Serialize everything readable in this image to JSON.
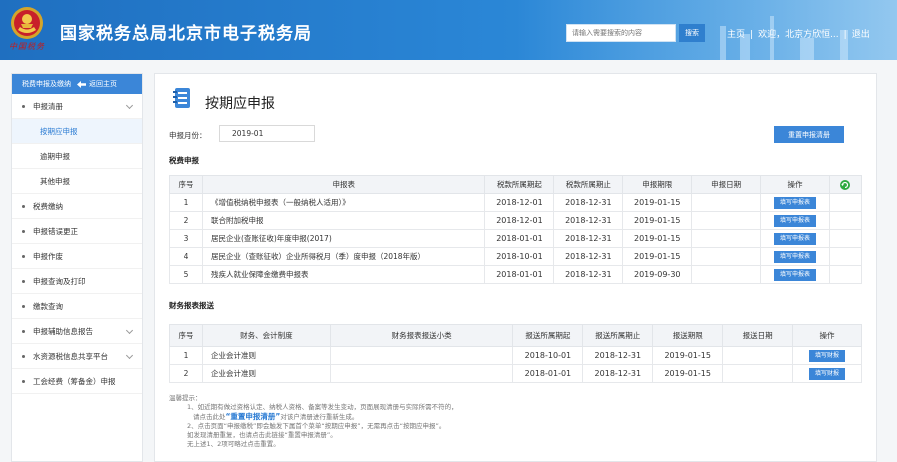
{
  "header": {
    "title": "国家税务总局北京市电子税务局",
    "emblem_text": "中国税务",
    "search_placeholder": "请输入需要搜索的内容",
    "search_button": "搜索",
    "links": [
      "主页",
      "欢迎，北京方欣恒...",
      "退出"
    ],
    "link_separator": "|"
  },
  "sidebar": {
    "head_label": "税费申报及缴纳",
    "back_label": "返回主页",
    "items": [
      {
        "label": "申报清册",
        "expandable": true
      },
      {
        "label": "按期应申报",
        "sub": true,
        "active": true
      },
      {
        "label": "逾期申报",
        "sub": true
      },
      {
        "label": "其他申报",
        "sub": true
      },
      {
        "label": "税费缴纳"
      },
      {
        "label": "申报错误更正"
      },
      {
        "label": "申报作废"
      },
      {
        "label": "申报查询及打印"
      },
      {
        "label": "缴款查询"
      },
      {
        "label": "申报辅助信息报告",
        "expandable": true
      },
      {
        "label": "水资源税信息共享平台",
        "expandable": true
      },
      {
        "label": "工会经费（筹备金）申报"
      }
    ]
  },
  "main": {
    "title": "按期应申报",
    "period_label": "申报月份：",
    "period_value": "2019-01",
    "reset_button": "重置申报清册",
    "tax_section_title": "税费申报",
    "tax_table": {
      "headers": [
        "序号",
        "申报表",
        "税款所属期起",
        "税款所属期止",
        "申报期限",
        "申报日期",
        "操作"
      ],
      "rows": [
        [
          "1",
          "《增值税纳税申报表（一般纳税人适用）》",
          "2018-12-01",
          "2018-12-31",
          "2019-01-15",
          "",
          "填写申报表"
        ],
        [
          "2",
          "联合附加税申报",
          "2018-12-01",
          "2018-12-31",
          "2019-01-15",
          "",
          "填写申报表"
        ],
        [
          "3",
          "居民企业(查账征收)年度申报(2017)",
          "2018-01-01",
          "2018-12-31",
          "2019-01-15",
          "",
          "填写申报表"
        ],
        [
          "4",
          "居民企业（查账征收）企业所得税月（季）度申报（2018年版）",
          "2018-10-01",
          "2018-12-31",
          "2019-01-15",
          "",
          "填写申报表"
        ],
        [
          "5",
          "残疾人就业保障金缴费申报表",
          "2018-01-01",
          "2018-12-31",
          "2019-09-30",
          "",
          "填写申报表"
        ]
      ]
    },
    "finance_section_title": "财务报表报送",
    "finance_table": {
      "headers": [
        "序号",
        "财务、会计制度",
        "财务报表报送小类",
        "报送所属期起",
        "报送所属期止",
        "报送期限",
        "报送日期",
        "操作"
      ],
      "rows": [
        [
          "1",
          "企业会计准则",
          "",
          "2018-10-01",
          "2018-12-31",
          "2019-01-15",
          "",
          "填写财报"
        ],
        [
          "2",
          "企业会计准则",
          "",
          "2018-01-01",
          "2018-12-31",
          "2019-01-15",
          "",
          "填写财报"
        ]
      ]
    },
    "tips": {
      "title": "温馨提示：",
      "line1": "1、如近期有做过资格认定、纳税人资格、备案等发生变动，页面展现清册与实际所需不符的，",
      "line2_prefix": "请点击此处",
      "line2_highlight": "“重置申报清册”",
      "line2_suffix": "对该户清册进行重新生成。",
      "line3": "2、点击页面“申报缴税”即会触发下属首个菜单“按期应申报”，无需再点击“按期应申报”。",
      "line4": "如发现清册重复，也请点击此链接“重置申报清册”。",
      "line5": "无上述1、2项可略过点击重置。"
    }
  },
  "colors": {
    "header_blue": "#2a86d6",
    "accent": "#3b86d8",
    "active_text": "#2a7bd3",
    "refresh_green": "#2eaa3f"
  }
}
